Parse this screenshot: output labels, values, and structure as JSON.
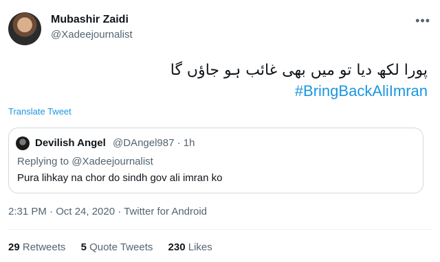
{
  "author": {
    "display_name": "Mubashir Zaidi",
    "handle": "@Xadeejournalist"
  },
  "more_icon": "more-options-icon",
  "tweet": {
    "urdu_text": "پورا لکھ دیا تو میں بھی غائب ہو جاؤں گا",
    "hashtag": "#BringBackAliImran",
    "translate_label": "Translate Tweet"
  },
  "quoted": {
    "display_name": "Devilish Angel",
    "meta": "@DAngel987 · 1h",
    "replying_to": "Replying to @Xadeejournalist",
    "text": "Pura lihkay na chor do sindh gov ali imran ko"
  },
  "timestamp": "2:31 PM · Oct 24, 2020 · Twitter for Android",
  "stats": {
    "retweets_count": "29",
    "retweets_label": "Retweets",
    "quotes_count": "5",
    "quotes_label": "Quote Tweets",
    "likes_count": "230",
    "likes_label": "Likes"
  },
  "colors": {
    "link": "#1b95e0",
    "secondary_text": "#536471",
    "border": "#cfd9de"
  }
}
